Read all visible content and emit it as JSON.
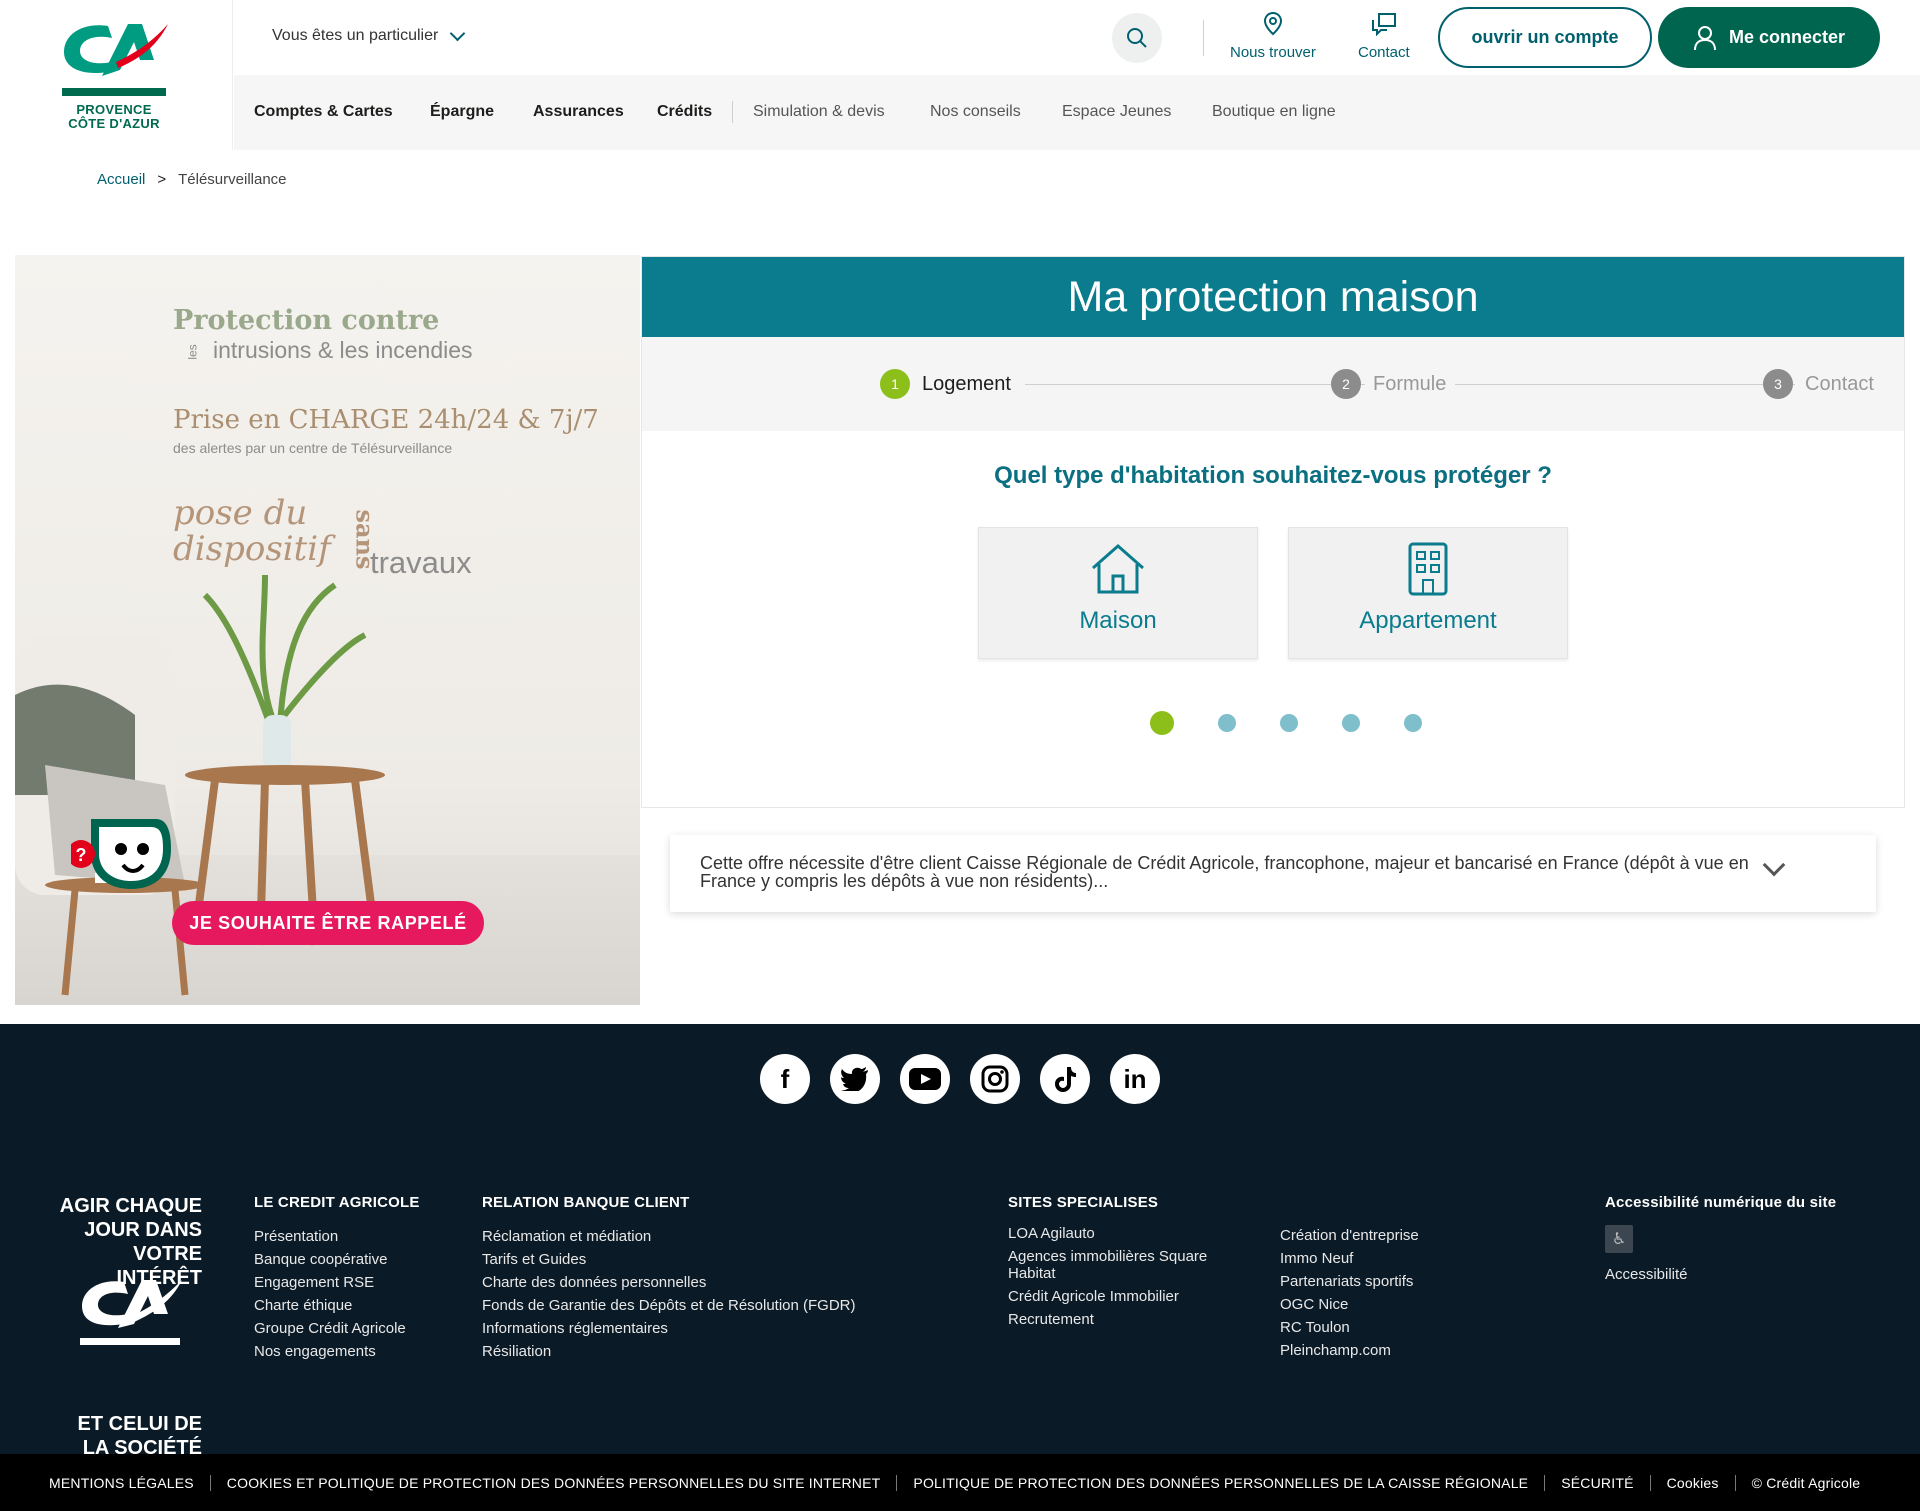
{
  "header": {
    "logo_text_line1": "PROVENCE",
    "logo_text_line2": "CÔTE D'AZUR",
    "profile_select": "Vous êtes un particulier",
    "tools": {
      "find": "Nous trouver",
      "contact": "Contact"
    },
    "open_account": "ouvrir un compte",
    "login": "Me connecter",
    "nav": [
      "Comptes & Cartes",
      "Épargne",
      "Assurances",
      "Crédits",
      "Simulation & devis",
      "Nos conseils",
      "Espace Jeunes",
      "Boutique en ligne"
    ]
  },
  "breadcrumb": {
    "home": "Accueil",
    "separator": ">",
    "current": "Télésurveillance"
  },
  "promo": {
    "line1": "Protection contre",
    "line2": "intrusions & les incendies",
    "line2_prefix": "les",
    "line3": "Prise en CHARGE 24h/24 & 7j/7",
    "line4": "des alertes par un centre de Télésurveillance",
    "line5a": "pose du",
    "line5b": "dispositif",
    "line6_prefix": "sans",
    "line6": "travaux",
    "callback": "JE SOUHAITE ÊTRE RAPPELÉ"
  },
  "widget": {
    "title": "Ma protection maison",
    "steps": [
      {
        "num": "1",
        "label": "Logement"
      },
      {
        "num": "2",
        "label": "Formule"
      },
      {
        "num": "3",
        "label": "Contact"
      }
    ],
    "question": "Quel type d'habitation souhaitez-vous protéger ?",
    "options": [
      {
        "label": "Maison",
        "icon": "house-icon"
      },
      {
        "label": "Appartement",
        "icon": "building-icon"
      }
    ],
    "progress": {
      "current": 1,
      "total": 5
    }
  },
  "offer_note": "Cette offre nécessite d'être client Caisse Régionale de Crédit Agricole, francophone, majeur et bancarisé en France (dépôt à vue en France y compris les dépôts à vue non résidents)...",
  "footer": {
    "socials": [
      "facebook-icon",
      "twitter-icon",
      "youtube-icon",
      "instagram-icon",
      "tiktok-icon",
      "linkedin-icon"
    ],
    "slogan_top": "AGIR CHAQUE JOUR DANS VOTRE INTÉRÊT",
    "slogan_bottom": "ET CELUI DE LA SOCIÉTÉ",
    "col1": {
      "title": "LE CREDIT AGRICOLE",
      "items": [
        "Présentation",
        "Banque coopérative",
        "Engagement RSE",
        "Charte éthique",
        "Groupe Crédit Agricole",
        "Nos engagements"
      ]
    },
    "col2": {
      "title": "RELATION BANQUE CLIENT",
      "items": [
        "Réclamation et médiation",
        "Tarifs et Guides",
        "Charte des données personnelles",
        "Fonds de Garantie des Dépôts et de Résolution (FGDR)",
        "Informations réglementaires",
        "Résiliation"
      ]
    },
    "col3": {
      "title": "SITES SPECIALISES",
      "items": [
        "LOA Agilauto",
        "Agences immobilières Square Habitat",
        "Crédit Agricole Immobilier",
        "Recrutement"
      ]
    },
    "col4": {
      "items": [
        "Création d'entreprise",
        "Immo Neuf",
        "Partenariats sportifs",
        "OGC Nice",
        "RC Toulon",
        "Pleinchamp.com"
      ]
    },
    "col5": {
      "title": "Accessibilité numérique du site",
      "link": "Accessibilité"
    }
  },
  "bottom_links": [
    "MENTIONS LÉGALES",
    "COOKIES ET POLITIQUE DE PROTECTION DES DONNÉES PERSONNELLES DU SITE INTERNET",
    "POLITIQUE DE PROTECTION DES DONNÉES PERSONNELLES DE LA CAISSE RÉGIONALE",
    "SÉCURITÉ",
    "Cookies",
    "© Crédit Agricole"
  ],
  "colors": {
    "brand_green": "#00654f",
    "teal": "#0a7c8e",
    "accent_green": "#8dbf1a",
    "pink": "#e6195f",
    "footer_bg": "#0a1a26"
  }
}
